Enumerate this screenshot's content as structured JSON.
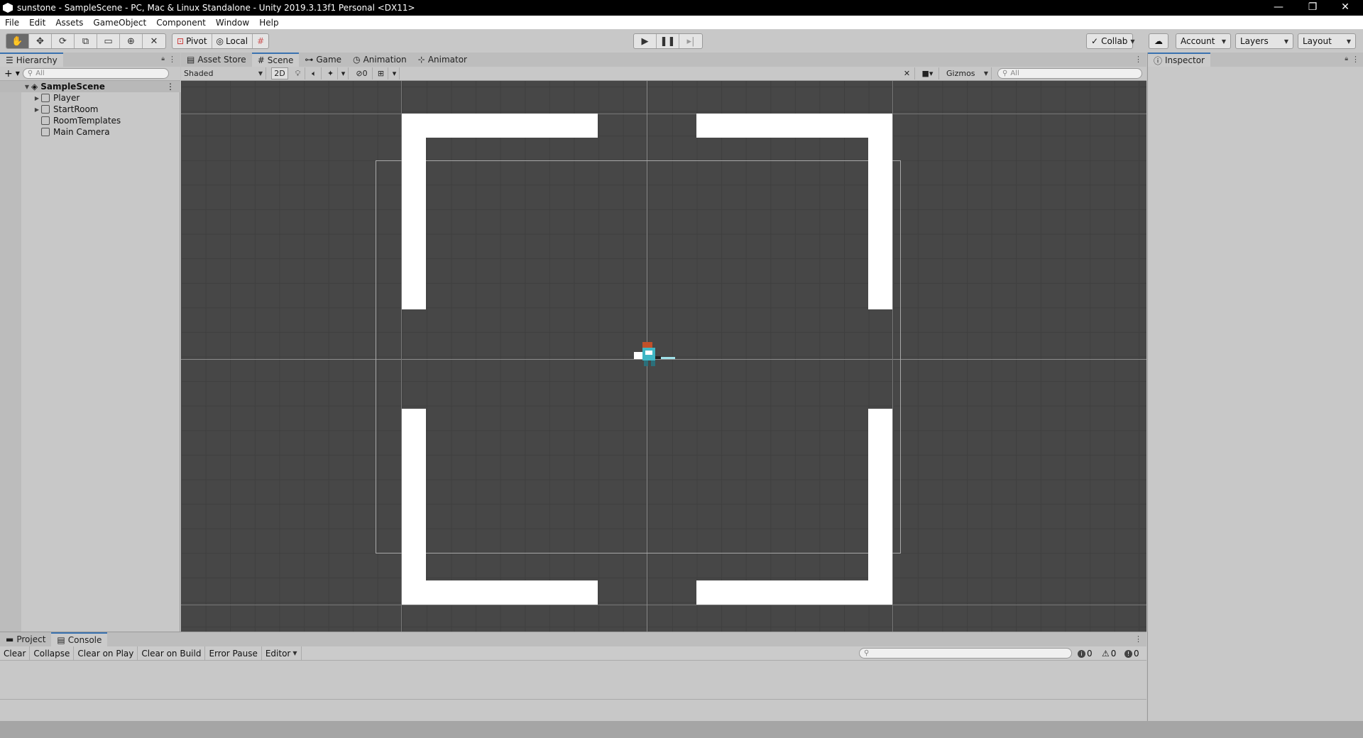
{
  "window": {
    "title": "sunstone - SampleScene - PC, Mac & Linux Standalone - Unity 2019.3.13f1 Personal <DX11>",
    "minimize": "—",
    "restore": "❐",
    "close": "✕"
  },
  "menu": [
    "File",
    "Edit",
    "Assets",
    "GameObject",
    "Component",
    "Window",
    "Help"
  ],
  "toolbar": {
    "pivot": "Pivot",
    "local": "Local",
    "collab": "Collab",
    "account": "Account",
    "layers": "Layers",
    "layout": "Layout"
  },
  "hierarchy": {
    "tab": "Hierarchy",
    "search_placeholder": "All",
    "scene": "SampleScene",
    "items": [
      "Player",
      "StartRoom",
      "RoomTemplates",
      "Main Camera"
    ]
  },
  "scene_tabs": [
    "Asset Store",
    "Scene",
    "Game",
    "Animation",
    "Animator"
  ],
  "scene_toolbar": {
    "shading": "Shaded",
    "mode_2d": "2D",
    "hidden_count": "0",
    "gizmos": "Gizmos",
    "search_placeholder": "All"
  },
  "inspector": {
    "tab": "Inspector"
  },
  "console": {
    "tabs": [
      "Project",
      "Console"
    ],
    "buttons": [
      "Clear",
      "Collapse",
      "Clear on Play",
      "Clear on Build",
      "Error Pause",
      "Editor"
    ],
    "info_count": "0",
    "warn_count": "0",
    "error_count": "0"
  },
  "colors": {
    "scene_bg": "#474747",
    "wall": "#ffffff",
    "active_tab": "#3a72b0"
  }
}
